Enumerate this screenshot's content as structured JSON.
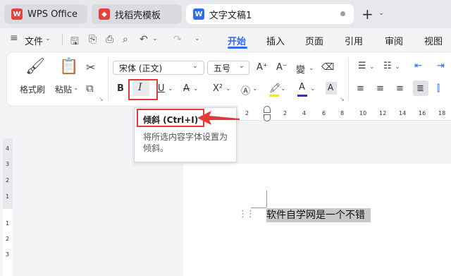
{
  "tabs": [
    {
      "label": "WPS Office",
      "icon": "wps-logo-icon",
      "icon_color": "#e8403a"
    },
    {
      "label": "找稻壳模板",
      "icon": "docer-logo-icon",
      "icon_color": "#e8403a"
    },
    {
      "label": "文字文稿1",
      "icon": "writer-doc-icon",
      "icon_color": "#2f6bf5"
    }
  ],
  "file_menu": "文件",
  "menu_tabs": [
    "开始",
    "插入",
    "页面",
    "引用",
    "审阅",
    "视图"
  ],
  "active_menu": "开始",
  "accent_color": "#2f6bf5",
  "ribbon": {
    "format_painter": "格式刷",
    "paste": "粘贴",
    "font_name": "宋体 (正文)",
    "font_size": "五号",
    "bold": "B",
    "italic": "I",
    "underline": "U",
    "strike": "ᴬ",
    "superscript": "X²"
  },
  "tooltip": {
    "title": "倾斜 (Ctrl+I)",
    "description": "将所选内容字体设置为倾斜。"
  },
  "ruler_numbers": [
    "2",
    "2",
    "4",
    "6",
    "8",
    "10",
    "12",
    "14",
    "16",
    "18"
  ],
  "left_ruler_numbers": [
    "4",
    "3",
    "2",
    "1",
    "1",
    "2",
    "3"
  ],
  "document_text": "软件自学网是一个不错",
  "annotation_color": "#e53935"
}
